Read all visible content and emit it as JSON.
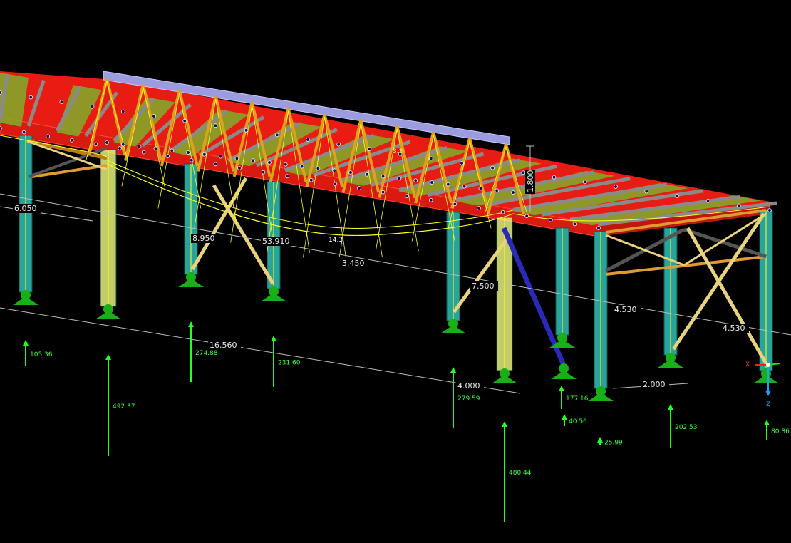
{
  "colors": {
    "background": "#000000",
    "slab": "#e81c12",
    "purlin": "#8a8a8a",
    "deck_panel": "#7fae2a",
    "truss": "#e0a01c",
    "top_chord": "#9b9bdf",
    "column": "#2aa39a",
    "column_highlight": "#e6f07a",
    "support": "#17b017",
    "reaction_arrow": "#22ff22",
    "deformation": "#ffff22",
    "brace": "#e9d27c",
    "diagonal_blue": "#2a2ab8"
  },
  "dimensions": [
    "6.050",
    "8.950",
    "53.910",
    "3.450",
    "7.500",
    "4.530",
    "4.530",
    "16.560",
    "4.000",
    "2.000"
  ],
  "truss_height_label": "1.800",
  "deformation_labels": [
    "14.3",
    "3.3"
  ],
  "reactions": [
    "105.36",
    "274.88",
    "231.60",
    "492.37",
    "279.59",
    "177.16",
    "40.56",
    "25.99",
    "202.53",
    "480.44",
    "80.86"
  ],
  "axes": {
    "x": "X",
    "z": "Z"
  }
}
